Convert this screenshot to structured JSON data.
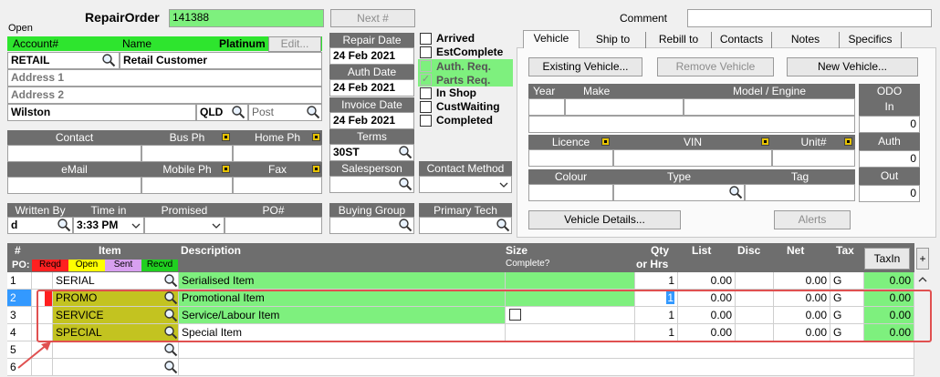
{
  "header": {
    "repair_order_label": "RepairOrder",
    "repair_order_value": "141388",
    "next_label": "Next #",
    "comment_label": "Comment",
    "status": "Open"
  },
  "customer": {
    "account_hdr": "Account#",
    "name_hdr": "Name",
    "level": "Platinum",
    "edit_label": "Edit...",
    "account": "RETAIL",
    "name": "Retail Customer",
    "address1": "Address 1",
    "address2": "Address 2",
    "suburb": "Wilston",
    "state": "QLD",
    "post_placeholder": "Post"
  },
  "contact": {
    "contact_hdr": "Contact",
    "bus_ph_hdr": "Bus Ph",
    "home_ph_hdr": "Home Ph",
    "email_hdr": "eMail",
    "mobile_ph_hdr": "Mobile Ph",
    "fax_hdr": "Fax"
  },
  "order": {
    "written_by_hdr": "Written By",
    "time_in_hdr": "Time in",
    "promised_hdr": "Promised",
    "po_hdr": "PO#",
    "written_by": "d",
    "time_in": "3:33 PM"
  },
  "dates": {
    "repair_date_hdr": "Repair Date",
    "repair_date": "24 Feb 2021",
    "auth_date_hdr": "Auth Date",
    "auth_date": "24 Feb 2021",
    "invoice_date_hdr": "Invoice Date",
    "invoice_date": "24 Feb 2021",
    "terms_hdr": "Terms",
    "terms": "30ST",
    "salesperson_hdr": "Salesperson",
    "contact_method_hdr": "Contact Method",
    "buying_group_hdr": "Buying Group",
    "primary_tech_hdr": "Primary Tech"
  },
  "status_checks": [
    {
      "label": "Arrived",
      "checked": false
    },
    {
      "label": "EstComplete",
      "checked": false
    },
    {
      "label": "Auth. Req.",
      "checked": false
    },
    {
      "label": "Parts Req.",
      "checked": true
    },
    {
      "label": "In Shop",
      "checked": false
    },
    {
      "label": "CustWaiting",
      "checked": false
    },
    {
      "label": "Completed",
      "checked": false
    }
  ],
  "tabs": [
    "Vehicle",
    "Ship to",
    "Rebill to",
    "Contacts",
    "Notes",
    "Specifics"
  ],
  "vehicle": {
    "existing_btn": "Existing Vehicle...",
    "remove_btn": "Remove Vehicle",
    "new_btn": "New Vehicle...",
    "year_hdr": "Year",
    "make_hdr": "Make",
    "model_hdr": "Model / Engine",
    "odo_hdr": "ODO",
    "in_hdr": "In",
    "in_value": "0",
    "auth_hdr": "Auth",
    "auth_value": "0",
    "out_hdr": "Out",
    "out_value": "0",
    "licence_hdr": "Licence",
    "vin_hdr": "VIN",
    "unit_hdr": "Unit#",
    "colour_hdr": "Colour",
    "type_hdr": "Type",
    "tag_hdr": "Tag",
    "details_btn": "Vehicle Details...",
    "alerts_btn": "Alerts"
  },
  "grid": {
    "hash_hdr": "#",
    "po_hdr": "PO:",
    "item_hdr": "Item",
    "desc_hdr": "Description",
    "size_hdr": "Size",
    "complete_hdr": "Complete?",
    "qty_hdr": "Qty",
    "hrs_hdr": "or Hrs",
    "list_hdr": "List",
    "disc_hdr": "Disc",
    "net_hdr": "Net",
    "tax_hdr": "Tax",
    "taxin_btn": "TaxIn",
    "plus_btn": "+",
    "po_states": [
      {
        "label": "Reqd",
        "color": "#ff2020"
      },
      {
        "label": "Open",
        "color": "#ffff00"
      },
      {
        "label": "Sent",
        "color": "#d8a0f0"
      },
      {
        "label": "Recvd",
        "color": "#20d020"
      }
    ],
    "rows": [
      {
        "n": "1",
        "item": "SERIAL",
        "desc": "Serialised Item",
        "qty": "1",
        "list": "0.00",
        "net": "0.00",
        "tax": "G",
        "taxin": "0.00"
      },
      {
        "n": "2",
        "item": "PROMO",
        "desc": "Promotional Item",
        "qty": "1",
        "list": "0.00",
        "net": "0.00",
        "tax": "G",
        "taxin": "0.00"
      },
      {
        "n": "3",
        "item": "SERVICE",
        "desc": "Service/Labour Item",
        "qty": "1",
        "list": "0.00",
        "net": "0.00",
        "tax": "G",
        "taxin": "0.00"
      },
      {
        "n": "4",
        "item": "SPECIAL",
        "desc": "Special Item",
        "qty": "1",
        "list": "0.00",
        "net": "0.00",
        "tax": "G",
        "taxin": "0.00"
      },
      {
        "n": "5",
        "item": "",
        "desc": "",
        "qty": "",
        "list": "",
        "net": "",
        "tax": "",
        "taxin": ""
      },
      {
        "n": "6",
        "item": "",
        "desc": "",
        "qty": "",
        "list": "",
        "net": "",
        "tax": "",
        "taxin": ""
      }
    ]
  },
  "colors": {
    "green": "#7ef07e",
    "olive": "#c3c320",
    "header_gray": "#6e6e6e",
    "highlight_blue": "#3399ff",
    "annotation_red": "#e05050"
  }
}
